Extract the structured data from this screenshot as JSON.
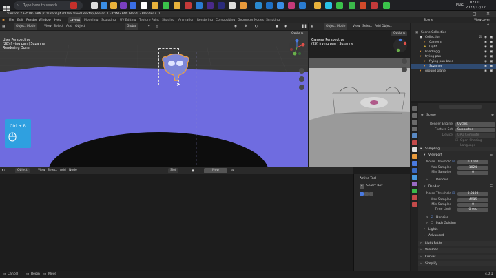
{
  "taskbar": {
    "search_placeholder": "Type here to search",
    "tray": {
      "lang": "ENG",
      "time": "02:00",
      "date": "2023/12/12"
    }
  },
  "titlebar": {
    "title": "*Lesson 2 FRYING PAN [C:\\Users\\pfull\\OneDrive\\Desktop\\Lesson 2 FRYING PAN.blend] - Blender 4.0"
  },
  "menubar": {
    "menus": [
      "File",
      "Edit",
      "Render",
      "Window",
      "Help"
    ],
    "workspaces": [
      "Layout",
      "Modeling",
      "Sculpting",
      "UV Editing",
      "Texture Paint",
      "Shading",
      "Animation",
      "Rendering",
      "Compositing",
      "Geometry Nodes",
      "Scripting"
    ],
    "scene": "Scene",
    "view_layer": "ViewLayer"
  },
  "viewport_left": {
    "mode": "Object Mode",
    "menus": [
      "View",
      "Select",
      "Add",
      "Object"
    ],
    "transform": "Global",
    "options": "Options",
    "overlay_lines": [
      "User Perspective",
      "(28) frying pan | Suzanne",
      "Rendering Done"
    ],
    "shortcut": "Ctrl + B"
  },
  "viewport_right": {
    "mode": "Object Mode",
    "menus": [
      "View",
      "Select",
      "Add",
      "Object"
    ],
    "options": "Options",
    "overlay_lines": [
      "Camera Perspective",
      "(28) frying pan | Suzanne"
    ]
  },
  "outliner": {
    "rows": [
      {
        "label": "Scene Collection",
        "indent": 0,
        "icon": "#aaa",
        "selected": false
      },
      {
        "label": "Collection",
        "indent": 1,
        "icon": "#ddd",
        "selected": false
      },
      {
        "label": "Camera",
        "indent": 2,
        "icon": "#e89a3c",
        "selected": false
      },
      {
        "label": "Light",
        "indent": 2,
        "icon": "#e8c23c",
        "selected": false
      },
      {
        "label": "Fried Egg",
        "indent": 1,
        "icon": "#e89a3c",
        "selected": false
      },
      {
        "label": "frying pan",
        "indent": 1,
        "icon": "#e89a3c",
        "selected": false
      },
      {
        "label": "frying pan base",
        "indent": 2,
        "icon": "#e89a3c",
        "selected": false
      },
      {
        "label": "Suzanne",
        "indent": 2,
        "icon": "#e89a3c",
        "selected": true
      },
      {
        "label": "ground plane",
        "indent": 1,
        "icon": "#e89a3c",
        "selected": false
      }
    ]
  },
  "properties": {
    "scene_name": "Scene",
    "render_engine_label": "Render Engine",
    "render_engine": "Cycles",
    "feature_set_label": "Feature Set",
    "feature_set": "Supported",
    "device_label": "Device",
    "device": "GPU Compute",
    "osl": "Open Shading Language",
    "sampling": "Sampling",
    "viewport": "Viewport",
    "noise_threshold_label": "Noise Threshold",
    "vp_noise_threshold": "0.1000",
    "max_samples_label": "Max Samples",
    "vp_max_samples": "1024",
    "min_samples_label": "Min Samples",
    "vp_min_samples": "0",
    "denoise_label": "Denoise",
    "render": "Render",
    "r_noise_threshold": "0.0100",
    "r_max_samples": "4096",
    "r_min_samples": "0",
    "time_limit_label": "Time Limit",
    "r_time_limit": "0 sec",
    "path_guiding": "Path Guiding",
    "lights": "Lights",
    "advanced": "Advanced",
    "light_paths": "Light Paths",
    "volumes": "Volumes",
    "curves": "Curves",
    "simplify": "Simplify"
  },
  "shader_editor": {
    "mode": "Object",
    "menus": [
      "View",
      "Select",
      "Add",
      "Node"
    ],
    "slot": "Slot",
    "new_button": "New"
  },
  "tool_panel": {
    "title": "Active Tool",
    "tool": "Select Box"
  },
  "statusbar": {
    "items": [
      "Cancel",
      "Begin",
      "Move"
    ],
    "version": "4.0.1"
  }
}
